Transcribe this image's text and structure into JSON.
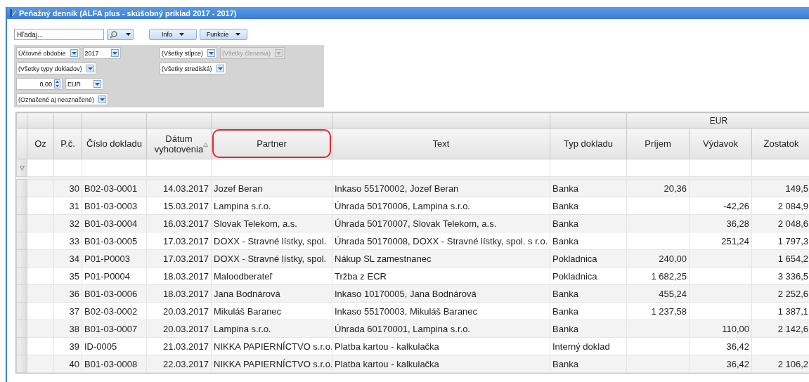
{
  "window": {
    "title": "Peňažný denník (ALFA plus - skúšobný príklad 2017 - 2017)"
  },
  "toolbar": {
    "search": {
      "placeholder": "Hľadaj..."
    },
    "buttons": [
      {
        "label": "Info"
      },
      {
        "label": "Funkcie"
      }
    ]
  },
  "filter_rows": [
    {
      "left": [
        {
          "kind": "combo",
          "value": "Účtovné obdobie",
          "disabled": false
        },
        {
          "kind": "combo",
          "value": "2017",
          "disabled": false
        }
      ],
      "right": [
        {
          "kind": "combo",
          "value": "(Všetky stĺpce)",
          "disabled": false
        },
        {
          "kind": "combo",
          "value": "(Všetky členenia)",
          "disabled": true
        }
      ]
    },
    {
      "left": [
        {
          "kind": "combo",
          "value": "(Všetky typy dokladov)",
          "disabled": false
        }
      ],
      "right": [
        {
          "kind": "combo",
          "value": "(Všetky strediská)",
          "disabled": false
        }
      ]
    },
    {
      "left": [
        {
          "kind": "spin",
          "value": "0,00",
          "disabled": false
        },
        {
          "kind": "combo",
          "value": "EUR",
          "disabled": false
        }
      ],
      "right": []
    },
    {
      "left": [
        {
          "kind": "combo",
          "value": "(Označené aj neoznačené)",
          "disabled": false
        }
      ],
      "right": []
    }
  ],
  "table": {
    "column_group": {
      "label": "EUR"
    },
    "columns": [
      {
        "label": "Oz",
        "highlighted": false,
        "sorted": false
      },
      {
        "label": "P.č.",
        "highlighted": false,
        "sorted": false
      },
      {
        "label": "Číslo dokladu",
        "highlighted": false,
        "sorted": false
      },
      {
        "label": "Dátum vyhotovenia",
        "highlighted": false,
        "sorted": true
      },
      {
        "label": "Partner",
        "highlighted": true,
        "sorted": false
      },
      {
        "label": "Text",
        "highlighted": false,
        "sorted": false
      },
      {
        "label": "Typ dokladu",
        "highlighted": false,
        "sorted": false
      },
      {
        "label": "Príjem",
        "highlighted": false,
        "sorted": false
      },
      {
        "label": "Výdavok",
        "highlighted": false,
        "sorted": false
      },
      {
        "label": "Zostatok",
        "highlighted": false,
        "sorted": false
      }
    ],
    "rows": [
      {
        "number": "30",
        "document": "B02-03-0001",
        "date": "14.03.2017",
        "partner": "Jozef Beran",
        "text": "Inkaso 55170002, Jozef Beran",
        "type": "Banka",
        "income": "20,36",
        "balance": "149,5"
      },
      {
        "number": "31",
        "document": "B01-03-0003",
        "date": "15.03.2017",
        "partner": "Lampina s.r.o.",
        "text": "Úhrada 50170006, Lampina s.r.o.",
        "type": "Banka",
        "expense": "-42,26",
        "balance": "2 084,9"
      },
      {
        "number": "32",
        "document": "B01-03-0004",
        "date": "16.03.2017",
        "partner": "Slovak Telekom, a.s.",
        "text": "Úhrada 50170007, Slovak Telekom, a.s.",
        "type": "Banka",
        "expense": "36,28",
        "balance": "2 048,6"
      },
      {
        "number": "33",
        "document": "B01-03-0005",
        "date": "17.03.2017",
        "partner": "DOXX - Stravné lístky, spol.",
        "text": "Úhrada 50170008, DOXX - Stravné lístky, spol. s r.o.",
        "type": "Banka",
        "expense": "251,24",
        "balance": "1 797,3"
      },
      {
        "number": "34",
        "document": "P01-P0003",
        "date": "17.03.2017",
        "partner": "DOXX - Stravné lístky, spol.",
        "text": "Nákup SL zamestnanec",
        "type": "Pokladnica",
        "income": "240,00",
        "balance": "1 654,2"
      },
      {
        "number": "35",
        "document": "P01-P0004",
        "date": "18.03.2017",
        "partner": "Maloodberateľ",
        "text": "Tržba z ECR",
        "type": "Pokladnica",
        "income": "1 682,25",
        "balance": "3 336,5"
      },
      {
        "number": "36",
        "document": "B01-03-0006",
        "date": "18.03.2017",
        "partner": "Jana Bodnárová",
        "text": "Inkaso 10170005, Jana Bodnárová",
        "type": "Banka",
        "income": "455,24",
        "balance": "2 252,6"
      },
      {
        "number": "37",
        "document": "B02-03-0002",
        "date": "20.03.2017",
        "partner": "Mikuláš Baranec",
        "text": "Inkaso 55170003, Mikuláš Baranec",
        "type": "Banka",
        "income": "1 237,58",
        "balance": "1 387,1"
      },
      {
        "number": "38",
        "document": "B01-03-0007",
        "date": "20.03.2017",
        "partner": "Lampina s.r.o.",
        "text": "Úhrada 60170001, Lampina s.r.o.",
        "type": "Banka",
        "expense": "110,00",
        "balance": "2 142,6"
      },
      {
        "number": "39",
        "document": "ID-0005",
        "date": "21.03.2017",
        "partner": "NIKKA PAPIERNÍCTVO s.r.o.",
        "text": "Platba kartou - kalkulačka",
        "type": "Interný doklad",
        "expense": "36,42"
      },
      {
        "number": "40",
        "document": "B01-03-0008",
        "date": "22.03.2017",
        "partner": "NIKKA PAPIERNÍCTVO s.r.o.",
        "text": "Platba kartou - kalkulačka",
        "type": "Banka",
        "expense": "36,42",
        "balance": "2 106,2"
      }
    ]
  }
}
